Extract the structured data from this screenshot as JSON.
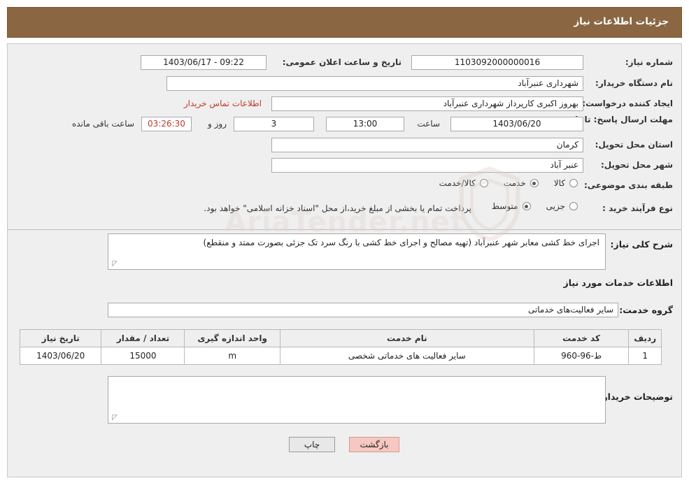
{
  "header": {
    "title": "جزئیات اطلاعات نیاز"
  },
  "watermark": {
    "text": "AriaTender.net",
    "shield_icon": "shield-icon"
  },
  "info": {
    "need_number_label": "شماره نیاز:",
    "need_number_value": "1103092000000016",
    "announce_datetime_label": "تاریخ و ساعت اعلان عمومی:",
    "announce_datetime_value": "09:22 - 1403/06/17",
    "buyer_org_label": "نام دستگاه خریدار:",
    "buyer_org_value": "شهرداری عنبرآباد",
    "creator_label": "ایجاد کننده درخواست:",
    "creator_value": "بهروز اکبری کارپرداز شهرداری عنبرآباد",
    "contact_link": "اطلاعات تماس خریدار",
    "deadline_label": "مهلت ارسال پاسخ: تا تاریخ:",
    "deadline_date": "1403/06/20",
    "deadline_hour_label": "ساعت",
    "deadline_hour_value": "13:00",
    "days_left_value": "3",
    "days_left_label": "روز و",
    "time_left_value": "03:26:30",
    "time_left_label": "ساعت باقی مانده",
    "province_label": "استان محل تحویل:",
    "province_value": "کرمان",
    "city_label": "شهر محل تحویل:",
    "city_value": "عنبر آباد",
    "category_label": "طبقه بندی موضوعی:",
    "category_options": [
      {
        "label": "کالا",
        "selected": false
      },
      {
        "label": "خدمت",
        "selected": true
      },
      {
        "label": "کالا/خدمت",
        "selected": false
      }
    ],
    "purchase_type_label": "نوع فرآیند خرید :",
    "purchase_type_options": [
      {
        "label": "جزیی",
        "selected": false
      },
      {
        "label": "متوسط",
        "selected": true
      }
    ],
    "purchase_note": "پرداخت تمام یا بخشی از مبلغ خرید،از محل \"اسناد خزانه اسلامی\" خواهد بود."
  },
  "description": {
    "label": "شرح کلی نیاز:",
    "value": "اجرای خط کشی معابر شهر عنبرآباد (تهیه مصالح و اجرای خط کشی با رنگ سرد تک جزئی بصورت ممتد و منقطع)"
  },
  "services": {
    "section_title": "اطلاعات خدمات مورد نیاز",
    "group_label": "گروه خدمت:",
    "group_value": "سایر فعالیت‌های خدماتی",
    "columns": [
      "ردیف",
      "کد خدمت",
      "نام خدمت",
      "واحد اندازه گیری",
      "تعداد / مقدار",
      "تاریخ نیاز"
    ],
    "rows": [
      {
        "index": "1",
        "code": "ط-96-960",
        "name": "سایر فعالیت های خدماتی شخصی",
        "unit": "m",
        "quantity": "15000",
        "date": "1403/06/20"
      }
    ]
  },
  "buyer_notes": {
    "label": "توضیحات خریدار;",
    "value": ""
  },
  "footer": {
    "print_label": "چاپ",
    "back_label": "بازگشت"
  }
}
